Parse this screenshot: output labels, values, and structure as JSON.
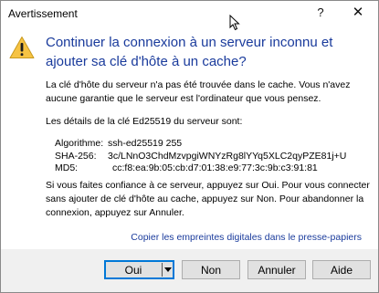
{
  "window": {
    "title": "Avertissement",
    "help_glyph": "?",
    "close_glyph": "✕"
  },
  "icon": "warning-icon",
  "heading": "Continuer la connexion à un serveur inconnu et ajouter sa clé d'hôte à un cache?",
  "paragraph1": {
    "line1": "La clé d'hôte du serveur n'a pas été trouvée dans le cache. Vous n'avez",
    "line2": "aucune garantie que le serveur est l'ordinateur que vous pensez."
  },
  "paragraph2": "Les détails de la clé Ed25519 du serveur sont:",
  "fingerprints": [
    {
      "label": "Algorithme:",
      "value": "ssh-ed25519 255"
    },
    {
      "label": "SHA-256:",
      "value": "3c/LNnO3ChdMzvpgiWNYzRg8lYYq5XLC2qyPZE81j+U"
    },
    {
      "label": "MD5:",
      "value": "cc:f8:ea:9b:05:cb:d7:01:38:e9:77:3c:9b:c3:91:81"
    }
  ],
  "paragraph4": {
    "line1": "Si vous faites confiance à ce serveur, appuyez sur Oui. Pour vous connecter",
    "line2": "sans ajouter de clé d'hôte au cache, appuyez sur Non. Pour abandonner la",
    "line3": "connexion, appuyez sur Annuler."
  },
  "copy_link": "Copier les empreintes digitales dans le presse-papiers",
  "buttons": {
    "oui": "Oui",
    "non": "Non",
    "annuler": "Annuler",
    "aide": "Aide"
  },
  "colors": {
    "heading": "#1a3b9c",
    "link": "#1a3b9c",
    "footer_bg": "#f0f0f0",
    "default_button_border": "#0078d7"
  }
}
